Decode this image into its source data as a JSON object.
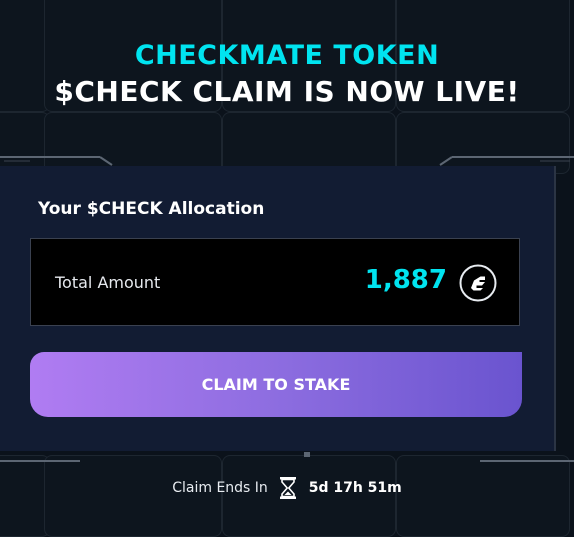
{
  "header": {
    "title": "CHECKMATE TOKEN",
    "subtitle": "$CHECK CLAIM IS NOW LIVE!"
  },
  "allocation": {
    "title": "Your $CHECK Allocation",
    "total_label": "Total Amount",
    "total_value": "1,887",
    "token_icon": "check-token-icon"
  },
  "actions": {
    "claim_label": "CLAIM TO STAKE"
  },
  "footer": {
    "ends_label": "Claim Ends In",
    "countdown": "5d 17h 51m",
    "timer_icon": "hourglass-icon"
  },
  "colors": {
    "accent_cyan": "#00e4f0",
    "panel_bg": "#121c33",
    "button_gradient_start": "#b07cf2",
    "button_gradient_end": "#6a54cf"
  }
}
